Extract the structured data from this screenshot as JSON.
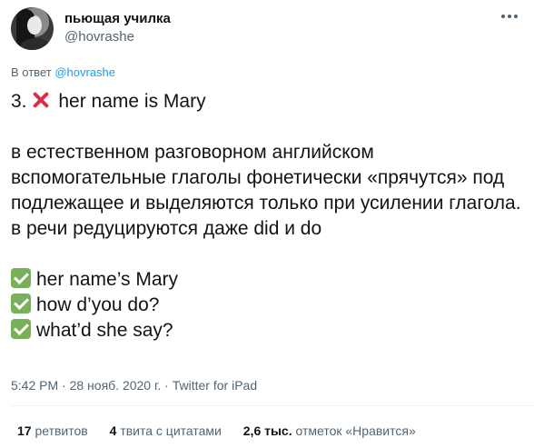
{
  "author": {
    "display_name": "пьющая училка",
    "handle": "@hovrashe"
  },
  "reply": {
    "prefix": "В ответ",
    "to_handle": "@hovrashe"
  },
  "tweet": {
    "line1_number": "3.",
    "line1_text": "her name is Mary",
    "paragraph": "в естественном разговорном английском вспомогательные глаголы фонетически «прячутся» под подлежащее и выделяются только при усилении глагола. в речи редуцируются даже did и do",
    "examples": [
      "her name’s Mary",
      "how d’you do?",
      "what’d she say?"
    ],
    "icons": {
      "wrong": "red-x-icon",
      "correct": "green-check-icon"
    },
    "colors": {
      "wrong": "#dd2e44",
      "correct": "#78b159"
    }
  },
  "meta": {
    "time": "5:42 PM",
    "date": "28 нояб. 2020 г.",
    "sep": "·",
    "source": "Twitter for iPad"
  },
  "stats": {
    "retweets_count": "17",
    "retweets_label": "ретвитов",
    "quotes_count": "4",
    "quotes_label": "твита с цитатами",
    "likes_count": "2,6 тыс.",
    "likes_label": "отметок «Нравится»"
  }
}
